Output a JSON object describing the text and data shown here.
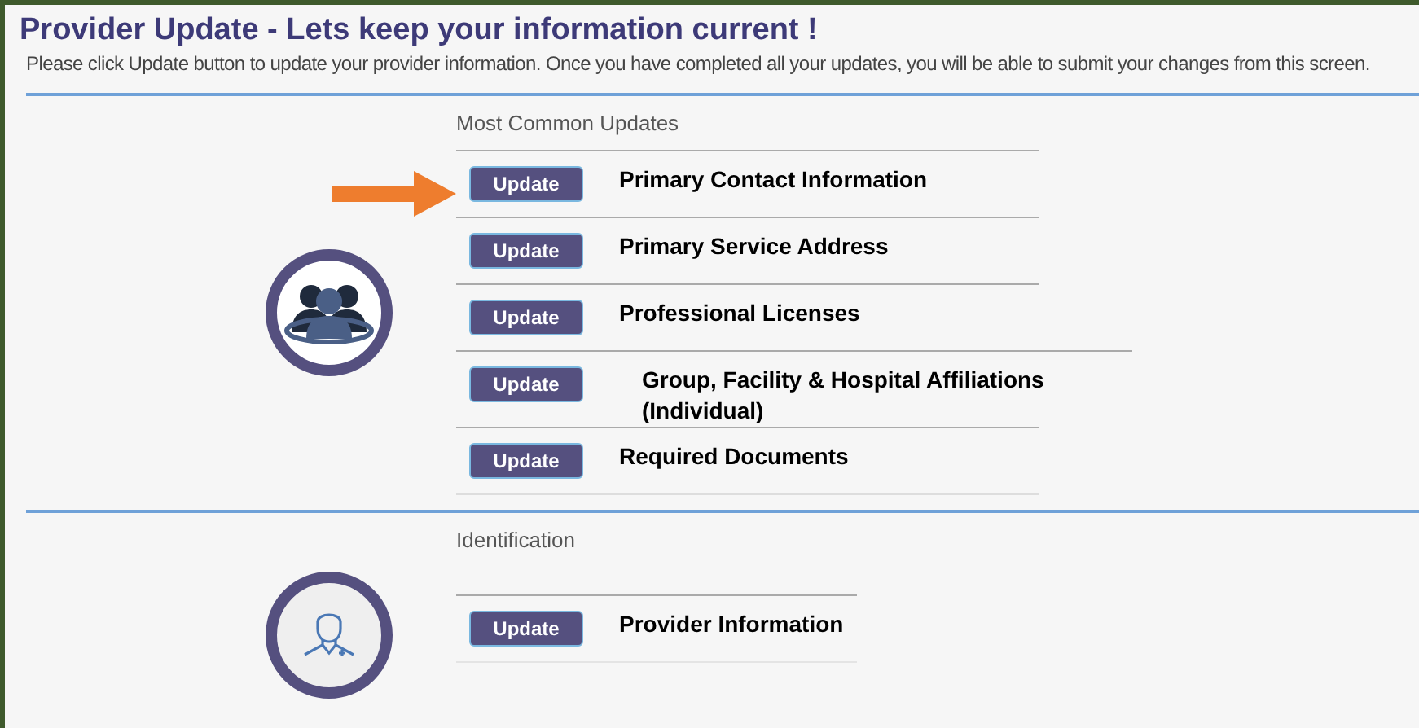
{
  "title": "Provider Update - Lets keep your information current !",
  "subtitle": "Please click Update button to update your provider information. Once you have completed all your updates, you will be able to submit your changes from this screen.",
  "sections": [
    {
      "kind": "group",
      "heading": "Most Common Updates",
      "items": [
        {
          "button": "Update",
          "label": "Primary Contact Information",
          "pointed": true,
          "indented": false
        },
        {
          "button": "Update",
          "label": "Primary Service Address",
          "pointed": false,
          "indented": false
        },
        {
          "button": "Update",
          "label": "Professional Licenses",
          "pointed": false,
          "indented": false
        },
        {
          "button": "Update",
          "label": "Group, Facility & Hospital Affiliations (Individual)",
          "pointed": false,
          "indented": true
        },
        {
          "button": "Update",
          "label": "Required Documents",
          "pointed": false,
          "indented": false
        }
      ]
    },
    {
      "kind": "person",
      "heading": "Identification",
      "items": [
        {
          "button": "Update",
          "label": "Provider Information",
          "pointed": false,
          "indented": false
        }
      ]
    }
  ]
}
